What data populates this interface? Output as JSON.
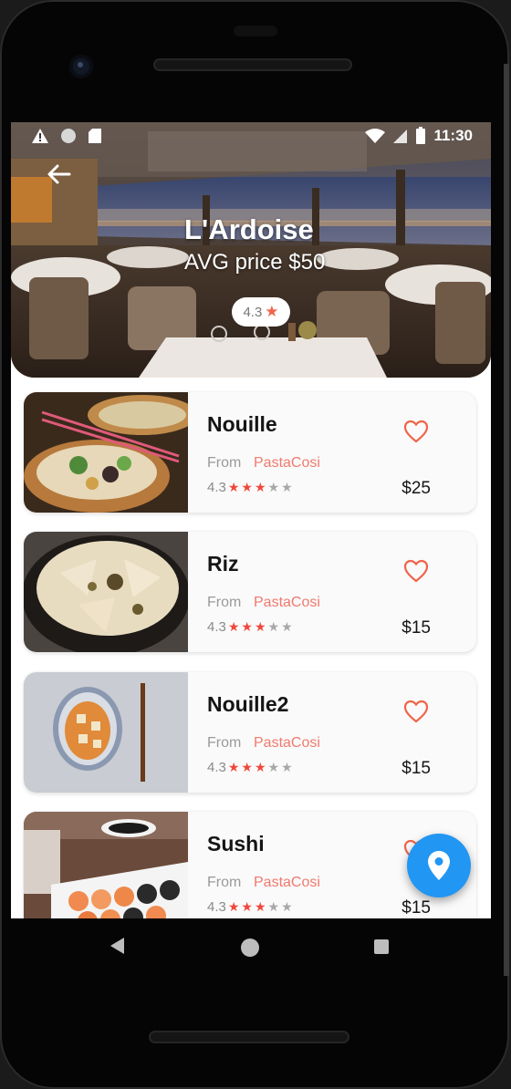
{
  "status_bar": {
    "time": "11:30",
    "icons": [
      "alert-icon",
      "circle-icon",
      "sim-card-icon",
      "wifi-icon",
      "signal-icon",
      "battery-icon"
    ]
  },
  "restaurant": {
    "name": "L'Ardoise",
    "avg_price": "AVG price $50",
    "rating": "4.3"
  },
  "dishes": [
    {
      "name": "Nouille",
      "from_label": "From",
      "restaurant": "PastaCosi",
      "rating": "4.3",
      "stars": 3,
      "price": "$25",
      "favorite_icon": "heart-outline-icon"
    },
    {
      "name": "Riz",
      "from_label": "From",
      "restaurant": "PastaCosi",
      "rating": "4.3",
      "stars": 3,
      "price": "$15",
      "favorite_icon": "heart-outline-icon"
    },
    {
      "name": "Nouille2",
      "from_label": "From",
      "restaurant": "PastaCosi",
      "rating": "4.3",
      "stars": 3,
      "price": "$15",
      "favorite_icon": "heart-outline-icon"
    },
    {
      "name": "Sushi",
      "from_label": "From",
      "restaurant": "PastaCosi",
      "rating": "4.3",
      "stars": 3,
      "price": "$15",
      "favorite_icon": "heart-outline-icon"
    }
  ],
  "colors": {
    "accent": "#f06449",
    "fab": "#2196f3",
    "restaurant_link": "#f07a6e"
  }
}
